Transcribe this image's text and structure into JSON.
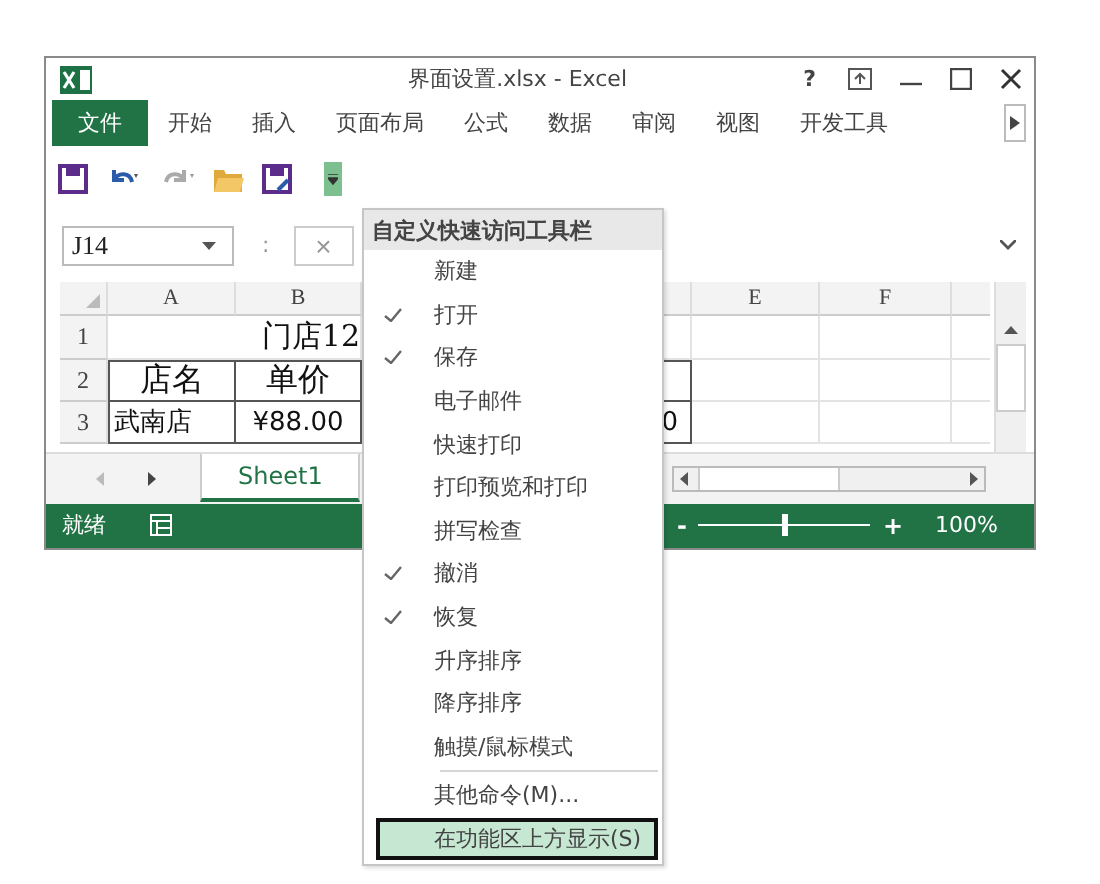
{
  "window": {
    "title": "界面设置.xlsx - Excel",
    "help": "?"
  },
  "ribbon_tabs": [
    {
      "label": "文件",
      "kind": "file",
      "selected": false
    },
    {
      "label": "开始",
      "kind": "tab",
      "selected": false
    },
    {
      "label": "插入",
      "kind": "tab",
      "selected": false
    },
    {
      "label": "页面布局",
      "kind": "tab",
      "selected": false
    },
    {
      "label": "公式",
      "kind": "tab",
      "selected": false
    },
    {
      "label": "数据",
      "kind": "tab",
      "selected": false
    },
    {
      "label": "审阅",
      "kind": "tab",
      "selected": false
    },
    {
      "label": "视图",
      "kind": "tab",
      "selected": false
    },
    {
      "label": "开发工具",
      "kind": "tab",
      "selected": false
    }
  ],
  "quick_access": {
    "customize_expanded": true
  },
  "name_box": {
    "value": "J14"
  },
  "formula_bar": {
    "separator": ":",
    "cancel": "×"
  },
  "sheet": {
    "columns": [
      {
        "label": "A"
      },
      {
        "label": "B"
      },
      {},
      {},
      {
        "label": "E"
      },
      {
        "label": "F"
      }
    ],
    "title_row": {
      "header": "1",
      "text": "门店12"
    },
    "rows": [
      {
        "header": "2",
        "cells": [
          {
            "text": "店名"
          },
          {
            "text": "单价"
          },
          {},
          {}
        ]
      },
      {
        "header": "3",
        "cells": [
          {
            "text": "武南店"
          },
          {
            "text": "¥88.00"
          },
          {},
          {
            "text": "0"
          }
        ]
      }
    ]
  },
  "sheet_tabs": [
    {
      "label": "Sheet1",
      "selected": true
    }
  ],
  "status_bar": {
    "text": "就绪",
    "zoom_minus": "-",
    "zoom_plus": "+",
    "zoom": "100%",
    "level": 0.5
  },
  "menu": {
    "title": "自定义快速访问工具栏",
    "items": [
      {
        "label": "新建",
        "checked": false,
        "selected": false
      },
      {
        "label": "打开",
        "checked": true,
        "selected": false
      },
      {
        "label": "保存",
        "checked": true,
        "selected": false
      },
      {
        "label": "电子邮件",
        "checked": false,
        "selected": false
      },
      {
        "label": "快速打印",
        "checked": false,
        "selected": false
      },
      {
        "label": "打印预览和打印",
        "checked": false,
        "selected": false
      },
      {
        "label": "拼写检查",
        "checked": false,
        "selected": false
      },
      {
        "label": "撤消",
        "checked": true,
        "selected": false
      },
      {
        "label": "恢复",
        "checked": true,
        "selected": false
      },
      {
        "label": "升序排序",
        "checked": false,
        "selected": false
      },
      {
        "label": "降序排序",
        "checked": false,
        "selected": false
      },
      {
        "label": "触摸/鼠标模式",
        "checked": false,
        "selected": false
      }
    ],
    "commands": [
      {
        "label": "其他命令(M)...",
        "selected": false
      },
      {
        "label": "在功能区上方显示(S)",
        "selected": true
      }
    ]
  }
}
